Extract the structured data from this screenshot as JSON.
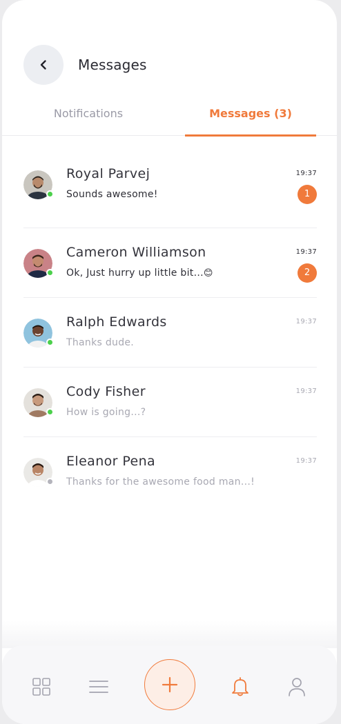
{
  "header": {
    "title": "Messages",
    "back_icon": "chevron-left-icon"
  },
  "tabs": [
    {
      "label": "Notifications",
      "active": false
    },
    {
      "label": "Messages (3)",
      "active": true
    }
  ],
  "conversations": [
    {
      "name": "Royal Parvej",
      "preview": "Sounds awesome!",
      "time": "19:37",
      "unread_count": "1",
      "online": true,
      "emoji": ""
    },
    {
      "name": "Cameron Williamson",
      "preview": "Ok, Just hurry up little bit...",
      "time": "19:37",
      "unread_count": "2",
      "online": true,
      "emoji": "😊"
    },
    {
      "name": "Ralph Edwards",
      "preview": "Thanks dude.",
      "time": "19:37",
      "unread_count": "",
      "online": true,
      "emoji": ""
    },
    {
      "name": "Cody Fisher",
      "preview": "How is going...?",
      "time": "19:37",
      "unread_count": "",
      "online": true,
      "emoji": ""
    },
    {
      "name": "Eleanor Pena",
      "preview": "Thanks for the awesome food man...!",
      "time": "19:37",
      "unread_count": "",
      "online": false,
      "emoji": ""
    }
  ],
  "bottom_nav": [
    {
      "icon": "grid-icon",
      "active": false
    },
    {
      "icon": "menu-icon",
      "active": false
    },
    {
      "icon": "plus-icon",
      "active": false
    },
    {
      "icon": "bell-icon",
      "active": true
    },
    {
      "icon": "user-icon",
      "active": false
    }
  ],
  "colors": {
    "accent": "#f07a3b",
    "online": "#4cd04c",
    "offline": "#b4b4bc"
  }
}
